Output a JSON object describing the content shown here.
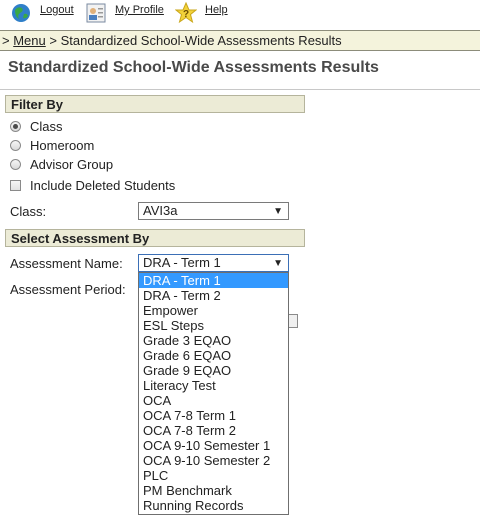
{
  "nav": {
    "logout": "Logout",
    "my_profile": "My Profile",
    "help": "Help"
  },
  "breadcrumb": {
    "separator": ">",
    "menu": "Menu",
    "current": "> Standardized School-Wide Assessments Results"
  },
  "page_title": "Standardized School-Wide Assessments Results",
  "filter": {
    "header": "Filter By",
    "options": [
      "Class",
      "Homeroom",
      "Advisor Group"
    ],
    "include_deleted": "Include Deleted Students",
    "class_label": "Class:",
    "class_value": "AVI3a"
  },
  "assessment": {
    "header": "Select Assessment By",
    "name_label": "Assessment Name:",
    "name_value": "DRA - Term 1",
    "period_label": "Assessment Period:",
    "options": [
      "DRA - Term 1",
      "DRA - Term 2",
      "Empower",
      "ESL Steps",
      "Grade 3 EQAO",
      "Grade 6 EQAO",
      "Grade 9 EQAO",
      "Literacy Test",
      "OCA",
      "OCA 7-8 Term 1",
      "OCA 7-8 Term 2",
      "OCA 9-10 Semester 1",
      "OCA 9-10 Semester 2",
      "PLC",
      "PM Benchmark",
      "Running Records"
    ]
  },
  "icons": {
    "logout": "globe-icon",
    "profile": "profile-card-icon",
    "help": "help-star-icon"
  },
  "colors": {
    "breadcrumb_bg": "#f4f3dc",
    "section_bg": "#ecebd6",
    "selected_bg": "#3399ff"
  }
}
